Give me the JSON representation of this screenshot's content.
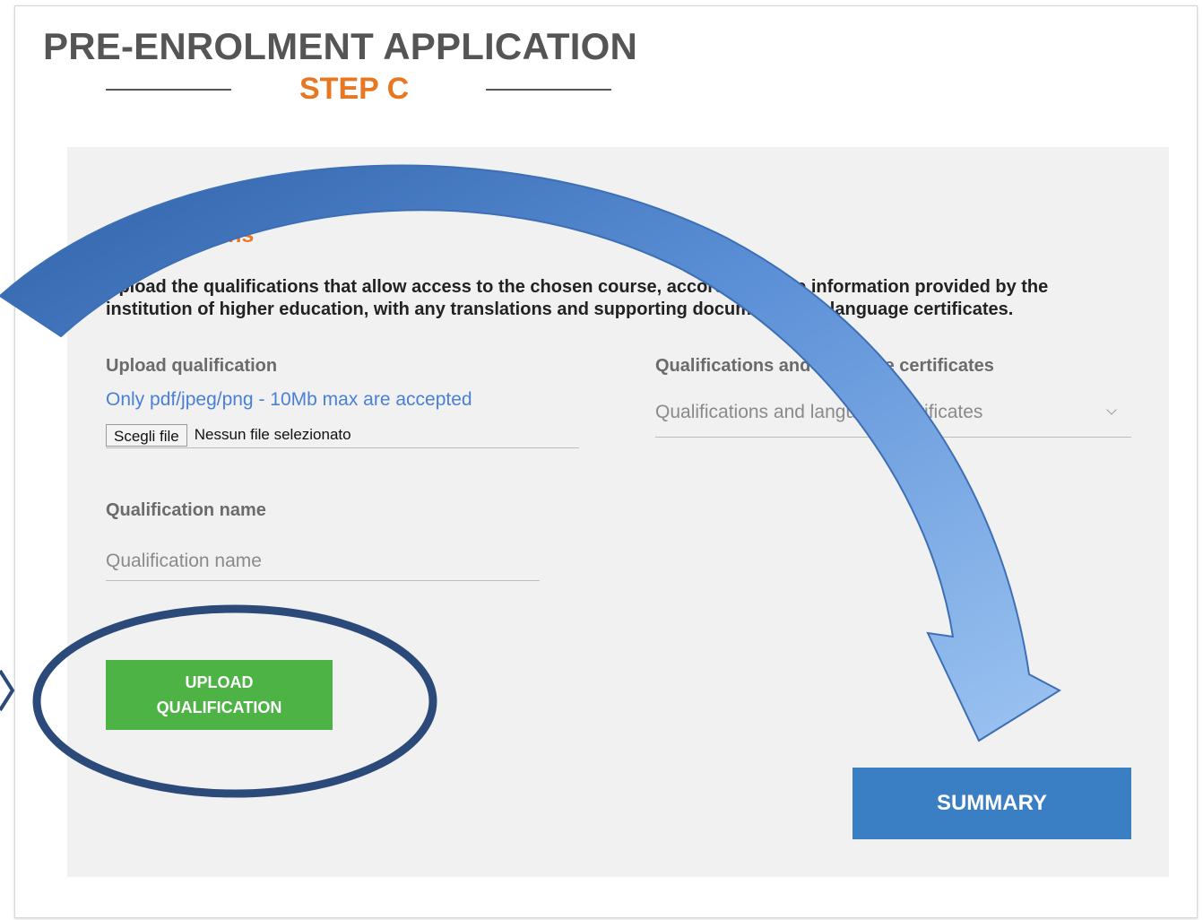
{
  "header": {
    "title": "PRE-ENROLMENT APPLICATION",
    "step": "STEP C"
  },
  "qualifications": {
    "section_title": "Qualifications",
    "instructions": "Upload the qualifications that allow access to the chosen course, according to the information provided by the institution of higher education, with any translations and supporting documents and language certificates.",
    "upload": {
      "label": "Upload qualification",
      "hint": "Only pdf/jpeg/png - 10Mb max are accepted",
      "choose_file_button": "Scegli file",
      "file_status": "Nessun file selezionato"
    },
    "certificates": {
      "label": "Qualifications and language certificates",
      "selected_value": "Qualifications and language certificates"
    },
    "name": {
      "label": "Qualification name",
      "placeholder": "Qualification name"
    },
    "upload_button": {
      "line1": "UPLOAD",
      "line2": "QUALIFICATION"
    },
    "summary_button": "SUMMARY"
  },
  "colors": {
    "accent_orange": "#e87722",
    "hint_blue": "#4a7fd6",
    "upload_green": "#4db345",
    "summary_blue": "#3a7ec4",
    "panel_bg": "#f1f1f1",
    "annotation_arrow": "#3a6fb8",
    "annotation_ring": "#2b4a7a"
  },
  "annotations": {
    "arrow_icon": "curved-arrow-icon",
    "ring_icon": "highlight-ellipse-icon",
    "pointer_icon": "chevron-right-icon"
  }
}
